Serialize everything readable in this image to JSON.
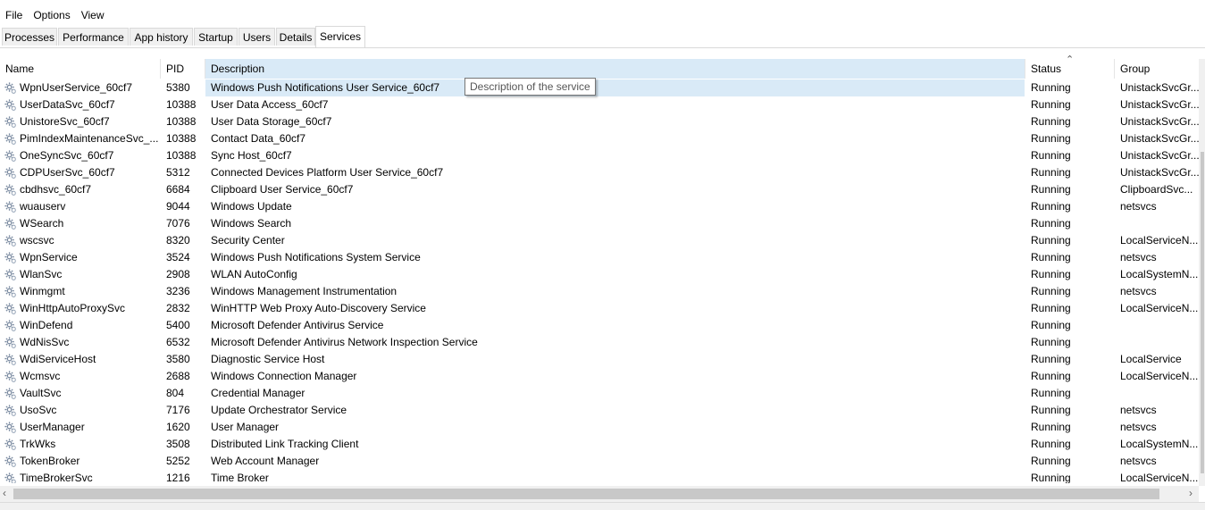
{
  "menu": {
    "file": "File",
    "options": "Options",
    "view": "View"
  },
  "tabs": [
    "Processes",
    "Performance",
    "App history",
    "Startup",
    "Users",
    "Details",
    "Services"
  ],
  "active_tab": "Services",
  "columns": {
    "name": "Name",
    "pid": "PID",
    "description": "Description",
    "status": "Status",
    "group": "Group"
  },
  "sorted_column": "Status",
  "tooltip": "Description of the service",
  "rows": [
    {
      "name": "WpnUserService_60cf7",
      "pid": "5380",
      "description": "Windows Push Notifications User Service_60cf7",
      "status": "Running",
      "group": "UnistackSvcGr..."
    },
    {
      "name": "UserDataSvc_60cf7",
      "pid": "10388",
      "description": "User Data Access_60cf7",
      "status": "Running",
      "group": "UnistackSvcGr..."
    },
    {
      "name": "UnistoreSvc_60cf7",
      "pid": "10388",
      "description": "User Data Storage_60cf7",
      "status": "Running",
      "group": "UnistackSvcGr..."
    },
    {
      "name": "PimIndexMaintenanceSvc_...",
      "pid": "10388",
      "description": "Contact Data_60cf7",
      "status": "Running",
      "group": "UnistackSvcGr..."
    },
    {
      "name": "OneSyncSvc_60cf7",
      "pid": "10388",
      "description": "Sync Host_60cf7",
      "status": "Running",
      "group": "UnistackSvcGr..."
    },
    {
      "name": "CDPUserSvc_60cf7",
      "pid": "5312",
      "description": "Connected Devices Platform User Service_60cf7",
      "status": "Running",
      "group": "UnistackSvcGr..."
    },
    {
      "name": "cbdhsvc_60cf7",
      "pid": "6684",
      "description": "Clipboard User Service_60cf7",
      "status": "Running",
      "group": "ClipboardSvc..."
    },
    {
      "name": "wuauserv",
      "pid": "9044",
      "description": "Windows Update",
      "status": "Running",
      "group": "netsvcs"
    },
    {
      "name": "WSearch",
      "pid": "7076",
      "description": "Windows Search",
      "status": "Running",
      "group": ""
    },
    {
      "name": "wscsvc",
      "pid": "8320",
      "description": "Security Center",
      "status": "Running",
      "group": "LocalServiceN..."
    },
    {
      "name": "WpnService",
      "pid": "3524",
      "description": "Windows Push Notifications System Service",
      "status": "Running",
      "group": "netsvcs"
    },
    {
      "name": "WlanSvc",
      "pid": "2908",
      "description": "WLAN AutoConfig",
      "status": "Running",
      "group": "LocalSystemN..."
    },
    {
      "name": "Winmgmt",
      "pid": "3236",
      "description": "Windows Management Instrumentation",
      "status": "Running",
      "group": "netsvcs"
    },
    {
      "name": "WinHttpAutoProxySvc",
      "pid": "2832",
      "description": "WinHTTP Web Proxy Auto-Discovery Service",
      "status": "Running",
      "group": "LocalServiceN..."
    },
    {
      "name": "WinDefend",
      "pid": "5400",
      "description": "Microsoft Defender Antivirus Service",
      "status": "Running",
      "group": ""
    },
    {
      "name": "WdNisSvc",
      "pid": "6532",
      "description": "Microsoft Defender Antivirus Network Inspection Service",
      "status": "Running",
      "group": ""
    },
    {
      "name": "WdiServiceHost",
      "pid": "3580",
      "description": "Diagnostic Service Host",
      "status": "Running",
      "group": "LocalService"
    },
    {
      "name": "Wcmsvc",
      "pid": "2688",
      "description": "Windows Connection Manager",
      "status": "Running",
      "group": "LocalServiceN..."
    },
    {
      "name": "VaultSvc",
      "pid": "804",
      "description": "Credential Manager",
      "status": "Running",
      "group": ""
    },
    {
      "name": "UsoSvc",
      "pid": "7176",
      "description": "Update Orchestrator Service",
      "status": "Running",
      "group": "netsvcs"
    },
    {
      "name": "UserManager",
      "pid": "1620",
      "description": "User Manager",
      "status": "Running",
      "group": "netsvcs"
    },
    {
      "name": "TrkWks",
      "pid": "3508",
      "description": "Distributed Link Tracking Client",
      "status": "Running",
      "group": "LocalSystemN..."
    },
    {
      "name": "TokenBroker",
      "pid": "5252",
      "description": "Web Account Manager",
      "status": "Running",
      "group": "netsvcs"
    },
    {
      "name": "TimeBrokerSvc",
      "pid": "1216",
      "description": "Time Broker",
      "status": "Running",
      "group": "LocalServiceN..."
    }
  ],
  "icons": {
    "service": "gear-icon",
    "sort": "sort-up-icon",
    "scroll_left": "scroll-left-arrow-icon",
    "scroll_right": "scroll-right-arrow-icon"
  },
  "colors": {
    "selected_header": "#d9eaf7",
    "tab_border": "#d9d9d9"
  }
}
